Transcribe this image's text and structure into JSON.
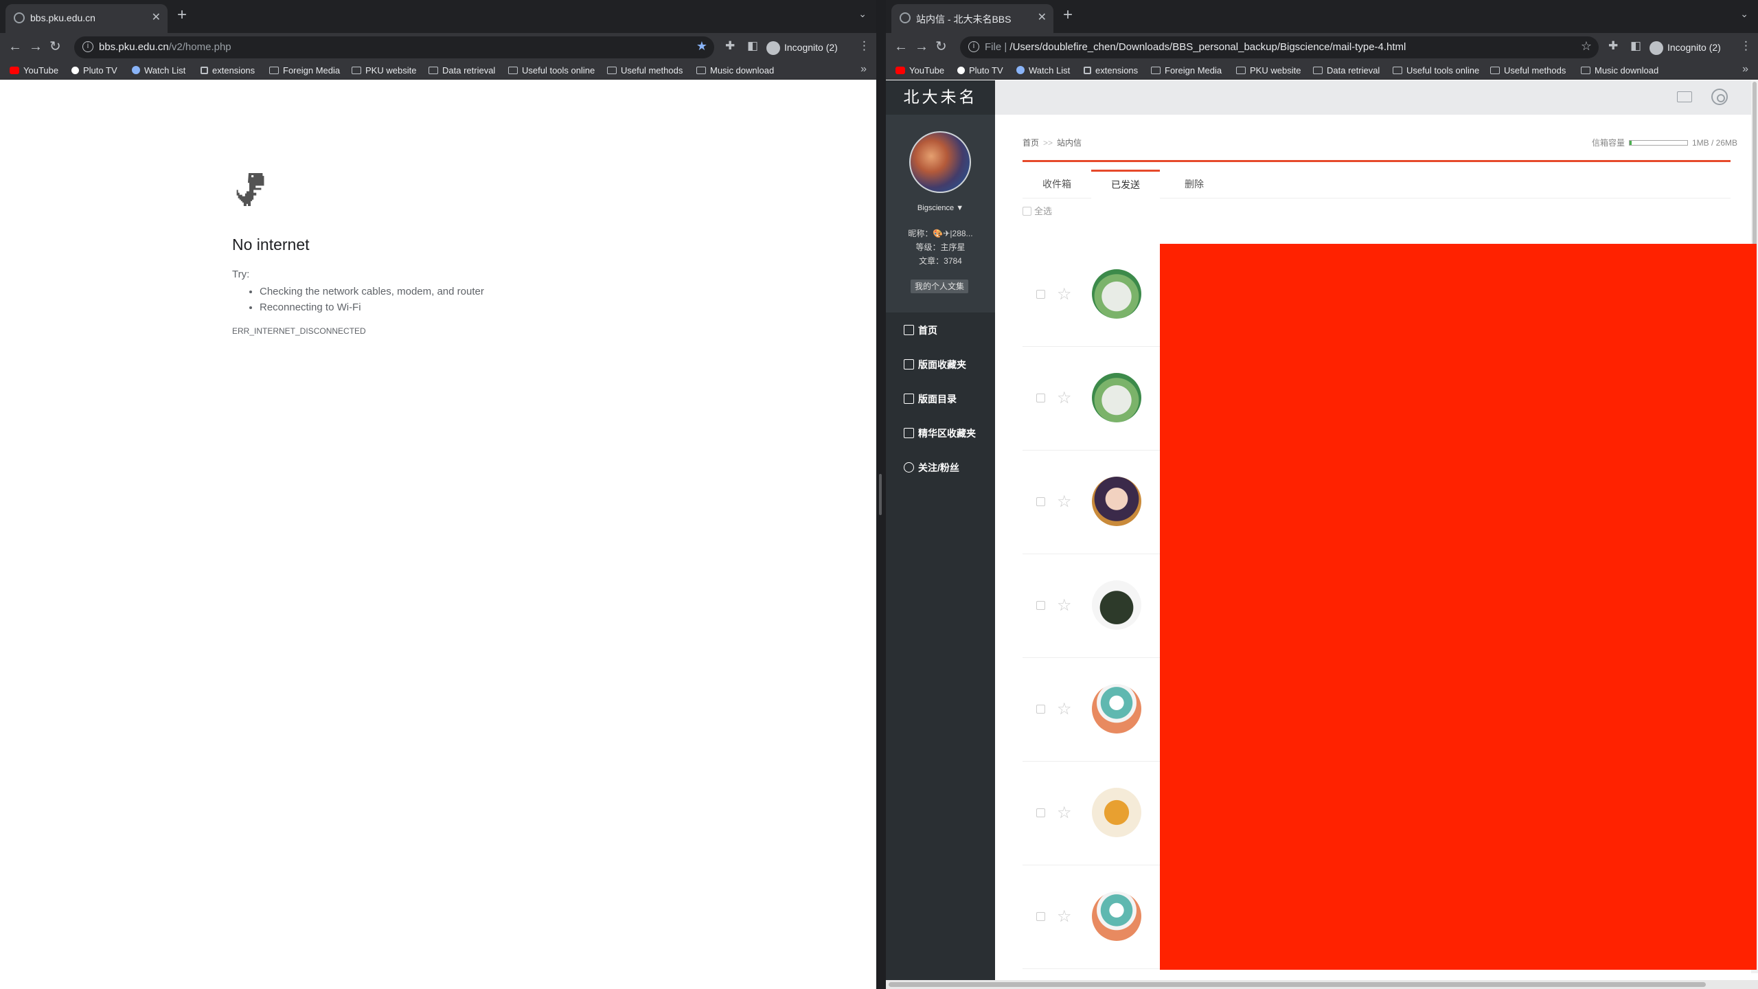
{
  "left": {
    "tab_title": "bbs.pku.edu.cn",
    "url_host": "bbs.pku.edu.cn",
    "url_path": "/v2/home.php",
    "incognito": "Incognito (2)",
    "bookmarks": [
      "YouTube",
      "Pluto TV",
      "Watch List",
      "extensions",
      "Foreign Media",
      "PKU website",
      "Data retrieval",
      "Useful tools online",
      "Useful methods",
      "Music download"
    ],
    "error": {
      "title": "No internet",
      "try": "Try:",
      "items": [
        "Checking the network cables, modem, and router",
        "Reconnecting to Wi-Fi"
      ],
      "code": "ERR_INTERNET_DISCONNECTED"
    }
  },
  "right": {
    "tab_title": "站内信 - 北大未名BBS",
    "url_prefix": "File",
    "url_path": "/Users/doublefire_chen/Downloads/BBS_personal_backup/Bigscience/mail-type-4.html",
    "incognito": "Incognito (2)",
    "bookmarks": [
      "YouTube",
      "Pluto TV",
      "Watch List",
      "extensions",
      "Foreign Media",
      "PKU website",
      "Data retrieval",
      "Useful tools online",
      "Useful methods",
      "Music download"
    ],
    "site": {
      "logo": "北大未名",
      "username": "Bigscience",
      "nickname": "昵称：🎨✈|288...",
      "level": "等级：主序星",
      "posts": "文章：3784",
      "collection_btn": "我的个人文集",
      "menu": [
        "首页",
        "版面收藏夹",
        "版面目录",
        "精华区收藏夹",
        "关注/粉丝"
      ],
      "breadcrumb_home": "首页",
      "breadcrumb_sep": ">>",
      "breadcrumb_current": "站内信",
      "quota_label": "信箱容量",
      "quota_text": "1MB / 26MB",
      "quota_fraction": 0.04,
      "tabs": [
        "收件箱",
        "已发送",
        "删除"
      ],
      "active_tab": "已发送",
      "select_all": "全选",
      "rows": [
        {
          "avatar": "duck-avatar"
        },
        {
          "avatar": "duck-avatar"
        },
        {
          "avatar": "anime-girl-avatar"
        },
        {
          "avatar": "fox-boy-avatar"
        },
        {
          "avatar": "default-avatar"
        },
        {
          "avatar": "garfield-avatar"
        },
        {
          "avatar": "default-avatar"
        }
      ]
    }
  },
  "colors": {
    "accent": "#e64a2b",
    "redaction": "#ff2200",
    "sidebar": "#2a2f33"
  }
}
